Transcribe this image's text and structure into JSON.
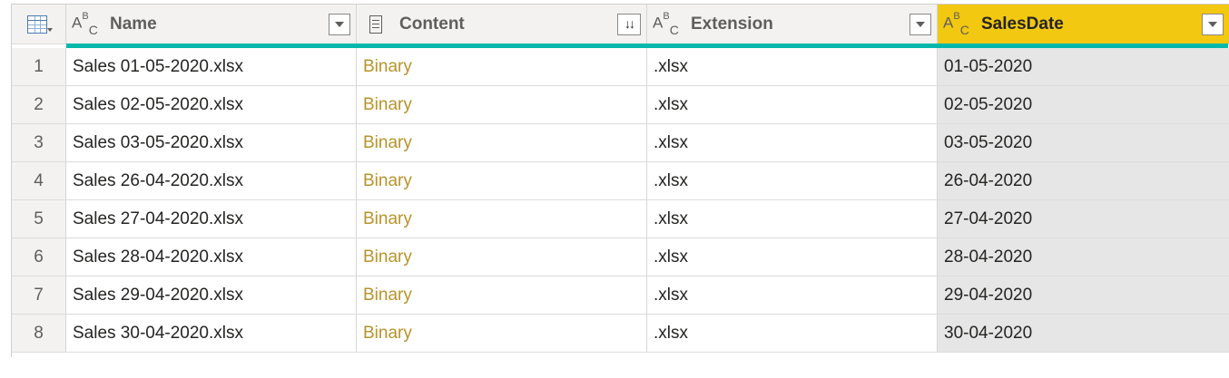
{
  "columns": [
    {
      "name": "Name",
      "type_icon": "abc-text-type-icon"
    },
    {
      "name": "Content",
      "type_icon": "document-binary-type-icon"
    },
    {
      "name": "Extension",
      "type_icon": "abc-text-type-icon"
    },
    {
      "name": "SalesDate",
      "type_icon": "abc-text-type-icon",
      "selected": true
    }
  ],
  "type_icon_text": {
    "a": "A",
    "b": "B",
    "c": "C"
  },
  "expand_glyph": "↓↓",
  "colors": {
    "accent_teal": "#01b8aa",
    "selected_header": "#f2c811",
    "binary_text": "#b8932a"
  },
  "rows": [
    {
      "index": "1",
      "name": "Sales 01-05-2020.xlsx",
      "content": "Binary",
      "extension": ".xlsx",
      "sales_date": "01-05-2020"
    },
    {
      "index": "2",
      "name": "Sales 02-05-2020.xlsx",
      "content": "Binary",
      "extension": ".xlsx",
      "sales_date": "02-05-2020"
    },
    {
      "index": "3",
      "name": "Sales 03-05-2020.xlsx",
      "content": "Binary",
      "extension": ".xlsx",
      "sales_date": "03-05-2020"
    },
    {
      "index": "4",
      "name": "Sales 26-04-2020.xlsx",
      "content": "Binary",
      "extension": ".xlsx",
      "sales_date": "26-04-2020"
    },
    {
      "index": "5",
      "name": "Sales 27-04-2020.xlsx",
      "content": "Binary",
      "extension": ".xlsx",
      "sales_date": "27-04-2020"
    },
    {
      "index": "6",
      "name": "Sales 28-04-2020.xlsx",
      "content": "Binary",
      "extension": ".xlsx",
      "sales_date": "28-04-2020"
    },
    {
      "index": "7",
      "name": "Sales 29-04-2020.xlsx",
      "content": "Binary",
      "extension": ".xlsx",
      "sales_date": "29-04-2020"
    },
    {
      "index": "8",
      "name": "Sales 30-04-2020.xlsx",
      "content": "Binary",
      "extension": ".xlsx",
      "sales_date": "30-04-2020"
    }
  ]
}
